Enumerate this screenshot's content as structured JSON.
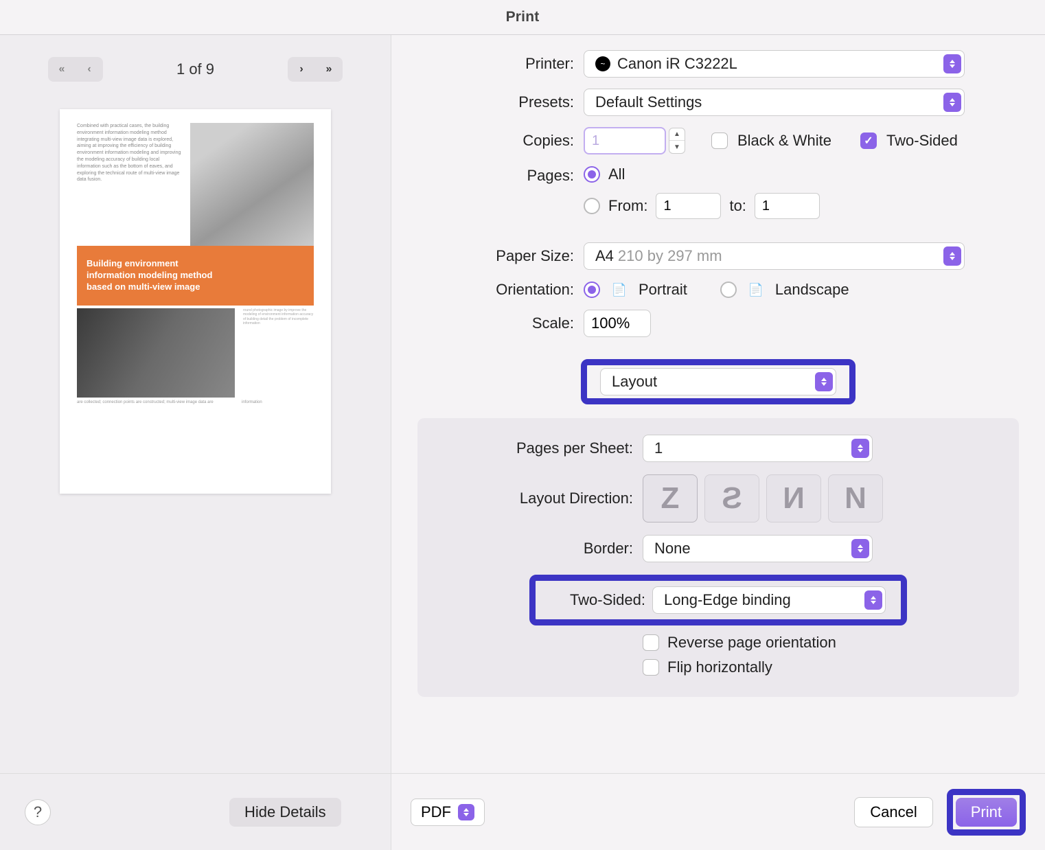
{
  "title": "Print",
  "preview": {
    "page_counter": "1 of 9",
    "thumb_text": "Combined with practical cases, the building environment information modeling method integrating multi-view image data is explored, aiming at improving the efficiency of building environment information modeling and improving the modeling accuracy of building local information such as the bottom of eaves, and exploring the technical route of multi-view image data fusion.",
    "banner_l1": "Building environment",
    "banner_l2": "information modeling method",
    "banner_l3": "based on multi-view image",
    "thumb_text2": "round photographic image by improve the modeling of environment information accuracy of building detail the problem of incomplete information",
    "thumb_footer": "are collected; connection points are constructed; multi-view image data are",
    "thumb_footer_col": "information"
  },
  "settings": {
    "printer_label": "Printer:",
    "printer_value": "Canon iR C3222L",
    "presets_label": "Presets:",
    "presets_value": "Default Settings",
    "copies_label": "Copies:",
    "copies_value": "1",
    "bw_label": "Black & White",
    "twosided_label": "Two-Sided",
    "pages_label": "Pages:",
    "pages_all": "All",
    "pages_from": "From:",
    "pages_from_value": "1",
    "pages_to": "to:",
    "pages_to_value": "1",
    "paper_label": "Paper Size:",
    "paper_value": "A4",
    "paper_hint": "210 by 297 mm",
    "orient_label": "Orientation:",
    "portrait": "Portrait",
    "landscape": "Landscape",
    "scale_label": "Scale:",
    "scale_value": "100%"
  },
  "layout": {
    "section_value": "Layout",
    "pps_label": "Pages per Sheet:",
    "pps_value": "1",
    "dir_label": "Layout Direction:",
    "border_label": "Border:",
    "border_value": "None",
    "twos_label": "Two-Sided:",
    "twos_value": "Long-Edge binding",
    "reverse": "Reverse page orientation",
    "flip": "Flip horizontally"
  },
  "footer": {
    "pdf": "PDF",
    "cancel": "Cancel",
    "print": "Print",
    "hide_details": "Hide Details"
  }
}
